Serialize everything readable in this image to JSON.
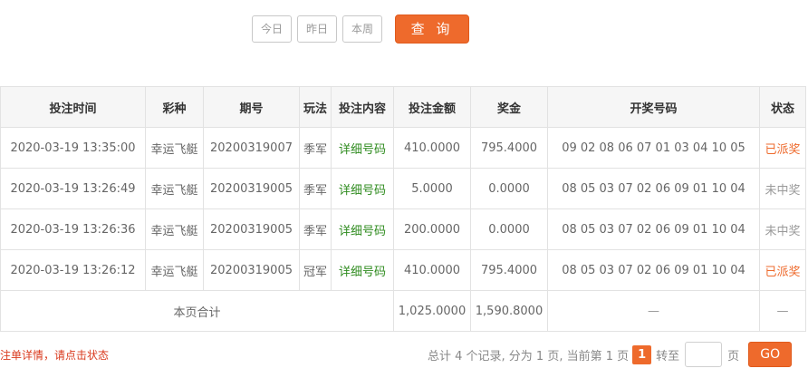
{
  "filter": {
    "today": "今日",
    "yesterday": "昨日",
    "this_week": "本周",
    "query": "查 询"
  },
  "table": {
    "headers": [
      "投注时间",
      "彩种",
      "期号",
      "玩法",
      "投注内容",
      "投注金额",
      "奖金",
      "开奖号码",
      "状态"
    ],
    "rows": [
      {
        "time": "2020-03-19 13:35:00",
        "lottery": "幸运飞艇",
        "issue": "20200319007",
        "play": "季军",
        "content": "详细号码",
        "amount": "410.0000",
        "prize": "795.4000",
        "numbers": "09 02 08 06 07 01 03 04 10 05",
        "status": "已派奖"
      },
      {
        "time": "2020-03-19 13:26:49",
        "lottery": "幸运飞艇",
        "issue": "20200319005",
        "play": "季军",
        "content": "详细号码",
        "amount": "5.0000",
        "prize": "0.0000",
        "numbers": "08 05 03 07 02 06 09 01 10 04",
        "status": "未中奖"
      },
      {
        "time": "2020-03-19 13:26:36",
        "lottery": "幸运飞艇",
        "issue": "20200319005",
        "play": "季军",
        "content": "详细号码",
        "amount": "200.0000",
        "prize": "0.0000",
        "numbers": "08 05 03 07 02 06 09 01 10 04",
        "status": "未中奖"
      },
      {
        "time": "2020-03-19 13:26:12",
        "lottery": "幸运飞艇",
        "issue": "20200319005",
        "play": "冠军",
        "content": "详细号码",
        "amount": "410.0000",
        "prize": "795.4000",
        "numbers": "08 05 03 07 02 06 09 01 10 04",
        "status": "已派奖"
      }
    ],
    "summary": {
      "label": "本页合计",
      "amount": "1,025.0000",
      "prize": "1,590.8000",
      "numbers": "—",
      "status": "—"
    }
  },
  "footer": {
    "notice": "注单详情，请点击状态",
    "pager_info": "总计 4 个记录, 分为 1 页, 当前第 1 页",
    "current_page": "1",
    "goto_label": "转至",
    "page_unit": "页",
    "go": "GO"
  },
  "colors": {
    "accent": "#ee6a2c",
    "detail_link": "#2e8b1e",
    "notice": "#d93a1e"
  }
}
